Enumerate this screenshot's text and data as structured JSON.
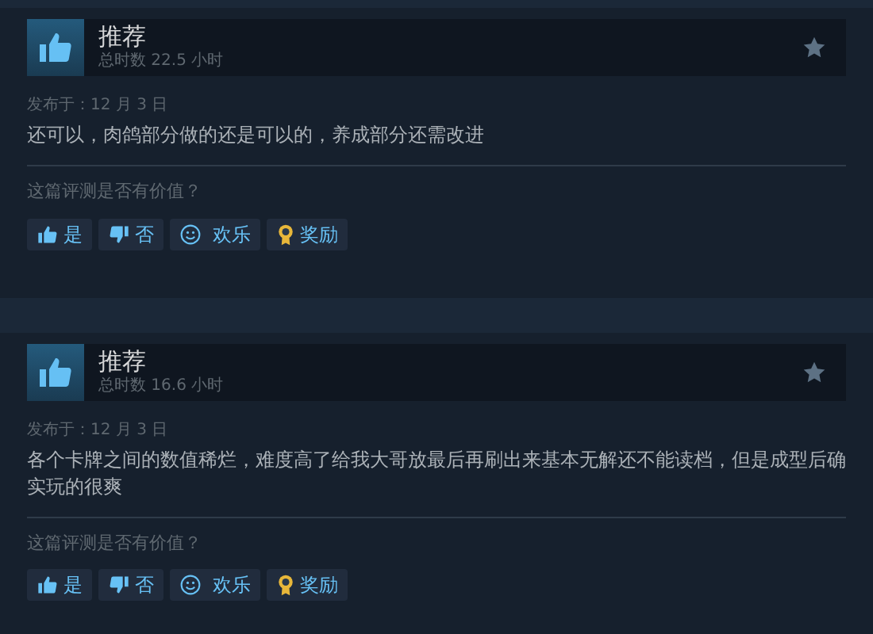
{
  "reviews": [
    {
      "verdict": "推荐",
      "recommended": true,
      "playtime": "总时数 22.5 小时",
      "posted": "发布于：12 月 3 日",
      "text": "还可以，肉鸽部分做的还是可以的，养成部分还需改进",
      "question": "这篇评测是否有价值？",
      "buttons": [
        {
          "kind": "yes",
          "label": "是"
        },
        {
          "kind": "no",
          "label": "否"
        },
        {
          "kind": "funny",
          "label": "欢乐"
        },
        {
          "kind": "award",
          "label": "奖励"
        }
      ]
    },
    {
      "verdict": "推荐",
      "recommended": true,
      "playtime": "总时数 16.6 小时",
      "posted": "发布于：12 月 3 日",
      "text": "各个卡牌之间的数值稀烂，难度高了给我大哥放最后再刷出来基本无解还不能读档，但是成型后确实玩的很爽",
      "question": "这篇评测是否有价值？",
      "buttons": [
        {
          "kind": "yes",
          "label": "是"
        },
        {
          "kind": "no",
          "label": "否"
        },
        {
          "kind": "funny",
          "label": "欢乐"
        },
        {
          "kind": "award",
          "label": "奖励"
        }
      ]
    }
  ]
}
